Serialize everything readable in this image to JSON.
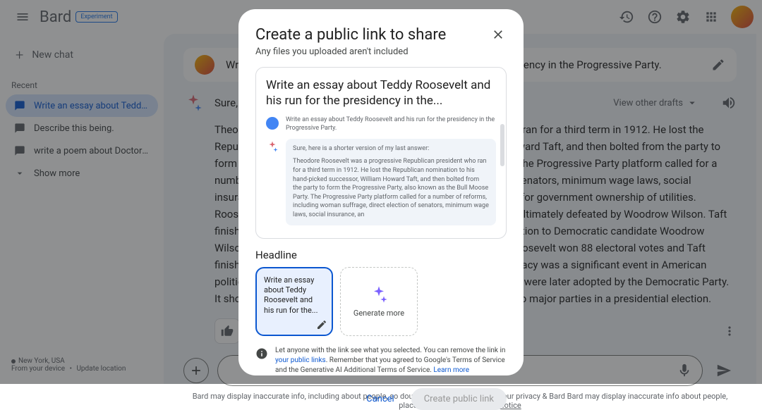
{
  "header": {
    "logo": "Bard",
    "badge": "Experiment"
  },
  "sidebar": {
    "new_chat": "New chat",
    "recent_label": "Recent",
    "items": [
      {
        "label": "Write an essay about Teddy Ro..."
      },
      {
        "label": "Describe this being."
      },
      {
        "label": "write a poem about Doctor Who"
      }
    ],
    "show_more": "Show more",
    "location": "New York, USA",
    "device_text": "From your device",
    "update_location": "Update location"
  },
  "conversation": {
    "prompt": "Write an essay about Teddy Roosevelt and his run for the presidency in the Progressive Party.",
    "response_intro": "Sure, here is a shorter version of my last answer:",
    "view_drafts": "View other drafts",
    "essay": "Theodore Roosevelt was a progressive Republican president who ran for a third term in 1912. He lost the Republican nomination to his hand-picked successor, William Howard Taft, and then bolted from the party to form the Progressive Party, also known as the Bull Moose Party. The Progressive Party platform called for a number of reforms, including woman suffrage, direct election of senators, minimum wage laws, social insurance, and regulation of the trusts. Roosevelt also advocated for government ownership of utilities. Roosevelt campaigned vigorously for the presidency, but he was ultimately defeated by Woodrow Wilson. Taft finished third, and the split in the Republican vote handed the election to Democratic candidate Woodrow Wilson. Wilson won the election with 435 electoral votes, while Roosevelt won 88 electoral votes and Taft finished third with 8 electoral votes. Roosevelt's third-party candidacy was a significant event in American political history, and it paved the way for many of the reforms that were later adopted by the Democratic Party. It showed that it was possible for a third party to challenge the two major parties in a presidential election."
  },
  "disclaimer": {
    "text": "Bard may display inaccurate info, including about people, so double-check its responses. Your privacy & Bard Bard may display inaccurate info about people, places & views.",
    "link": "Bard Privacy Notice"
  },
  "modal": {
    "title": "Create a public link to share",
    "subtitle": "Any files you uploaded aren't included",
    "preview": {
      "title": "Write an essay about Teddy Roosevelt and his run for the presidency in the...",
      "user_text": "Write an essay about Teddy Roosevelt and his run for the presidency in the Progressive Party.",
      "bard_intro": "Sure, here is a shorter version of my last answer:",
      "bard_body": "Theodore Roosevelt was a progressive Republican president who ran for a third term in 1912. He lost the Republican nomination to his hand-picked successor, William Howard Taft, and then bolted from the party to form the Progressive Party, also known as the Bull Moose Party. The Progressive Party platform called for a number of reforms, including woman suffrage, direct election of senators, minimum wage laws, social insurance, an"
    },
    "headline_label": "Headline",
    "headline_card": "Write an essay about Teddy Roosevelt and his run for the...",
    "generate_more": "Generate more",
    "info_text_1": "Let anyone with the link see what you selected. You can remove the link in ",
    "info_link_1": "your public links",
    "info_text_2": ". Remember that you agreed to Google's Terms of Service and the Generative AI Additional Terms of Service. ",
    "info_link_2": "Learn more",
    "cancel": "Cancel",
    "create": "Create public link"
  }
}
